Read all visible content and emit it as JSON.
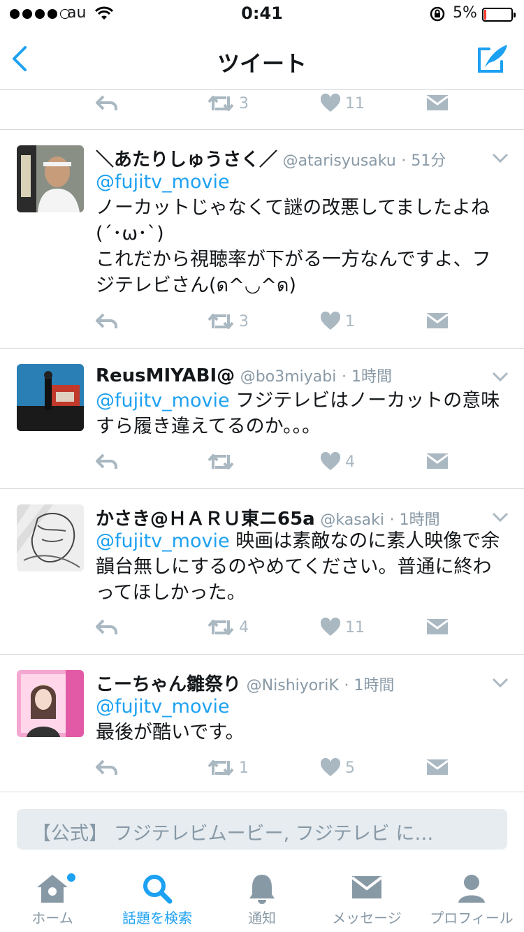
{
  "status": {
    "carrier": "au",
    "time": "0:41",
    "battery_percent": "5%",
    "signal_bars": 4
  },
  "nav": {
    "title": "ツイート",
    "back_icon": "chevron-left-icon",
    "compose_icon": "compose-tweet-icon"
  },
  "top_actions": {
    "retweets": "3",
    "likes": "11"
  },
  "tweets": [
    {
      "name": "＼あたりしゅうさく／",
      "handle": "@atarisyusaku",
      "time": "· 51分",
      "mention": "@fujitv_movie",
      "text_lines": [
        "ノーカットじゃなくて謎の改悪してましたよね",
        "(´･ω･`)",
        "これだから視聴率が下がる一方なんですよ、フ",
        "ジテレビさん(ด^◡^ด)"
      ],
      "retweets": "3",
      "likes": "1"
    },
    {
      "name": "ReusMIYABI@",
      "handle": "@bo3miyabi",
      "time": "· 1時間",
      "mention": "@fujitv_movie",
      "text_first": " フジテレビはノーカットの意味",
      "text_lines": [
        "すら履き違えてるのか。。。"
      ],
      "retweets": "",
      "likes": "4"
    },
    {
      "name": "かさき@ＨＡＲＵ東ニ65a",
      "handle": "@kasaki",
      "time": "· 1時間",
      "mention": "@fujitv_movie",
      "text_first": " 映画は素敵なのに素人映像で余",
      "text_lines": [
        "韻台無しにするのやめてください。普通に終わ",
        "ってほしかった。"
      ],
      "retweets": "4",
      "likes": "11"
    },
    {
      "name": "こーちゃん雛祭り",
      "handle": "@NishiyoriK",
      "time": "· 1時間",
      "mention": "@fujitv_movie",
      "text_lines": [
        "最後が酷いです。"
      ],
      "retweets": "1",
      "likes": "5"
    }
  ],
  "search_bar": {
    "text": "【公式】 フジテレビムービー, フジテレビ に…"
  },
  "tabs": [
    {
      "label": "ホーム",
      "icon": "home-icon"
    },
    {
      "label": "話題を検索",
      "icon": "search-icon"
    },
    {
      "label": "通知",
      "icon": "bell-icon"
    },
    {
      "label": "メッセージ",
      "icon": "envelope-icon"
    },
    {
      "label": "プロフィール",
      "icon": "person-icon"
    }
  ]
}
